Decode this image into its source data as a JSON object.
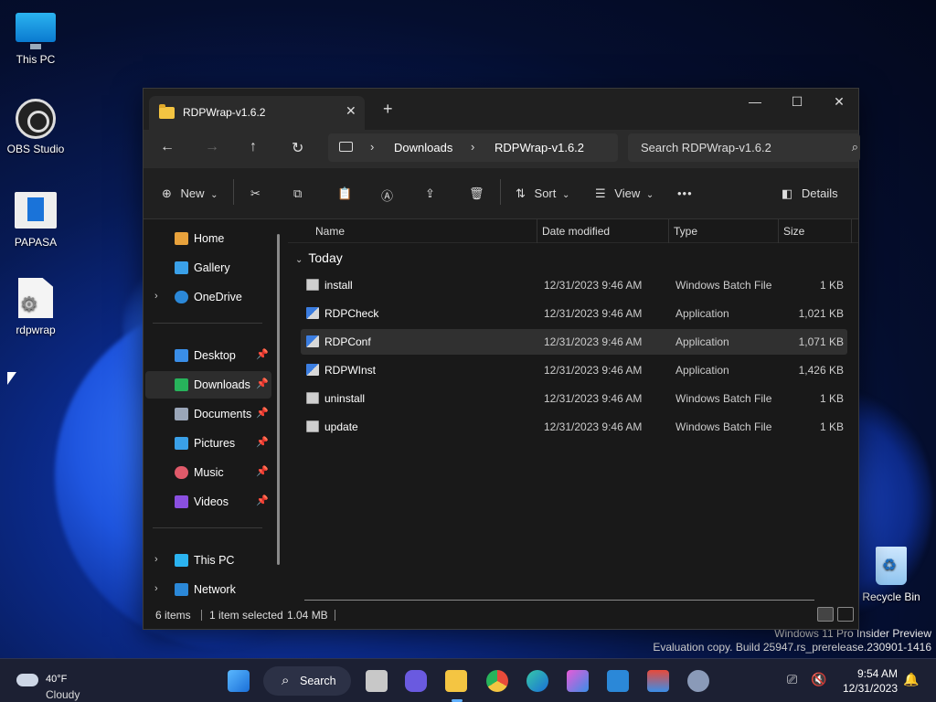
{
  "desktop": {
    "icons": [
      {
        "label": "This PC"
      },
      {
        "label": "OBS Studio"
      },
      {
        "label": "PAPASA"
      },
      {
        "label": "rdpwrap"
      },
      {
        "label": "Recycle Bin"
      }
    ],
    "watermark": {
      "line1": "Windows 11 Pro Insider Preview",
      "line2": "Evaluation copy. Build 25947.rs_prerelease.230901-1416"
    }
  },
  "window": {
    "tab_title": "RDPWrap-v1.6.2",
    "tab_close": "✕",
    "new_tab": "+",
    "controls": {
      "minimize": "—",
      "maximize": "☐",
      "close": "✕"
    },
    "nav": {
      "back": "←",
      "forward": "→",
      "up": "↑",
      "refresh": "↻"
    },
    "breadcrumb": [
      "Downloads",
      "RDPWrap-v1.6.2"
    ],
    "breadcrumb_sep": "›",
    "search_placeholder": "Search RDPWrap-v1.6.2",
    "search_icon": "⌕",
    "toolbar": {
      "new_label": "New",
      "sort_label": "Sort",
      "view_label": "View",
      "more_label": "•••",
      "details_label": "Details",
      "glyphs": {
        "new": "⊕",
        "cut": "✂",
        "copy": "⧉",
        "paste": "📋",
        "rename": "Ⓐ",
        "share": "⇪",
        "delete": "🗑",
        "sort": "⇅",
        "view": "☰",
        "details": "◧",
        "chev": "⌄"
      }
    },
    "sidebar": {
      "items": [
        {
          "label": "Home",
          "icon": "home-icon",
          "color": "#e8a23c"
        },
        {
          "label": "Gallery",
          "icon": "gallery-icon",
          "color": "#3aa0e8"
        },
        {
          "label": "OneDrive",
          "icon": "onedrive-icon",
          "color": "#2b88d8",
          "expandable": true
        },
        {
          "label": "Desktop",
          "icon": "desktop-icon",
          "color": "#3a8ee8",
          "pinned": true
        },
        {
          "label": "Downloads",
          "icon": "downloads-icon",
          "color": "#27b35b",
          "pinned": true,
          "selected": true
        },
        {
          "label": "Documents",
          "icon": "documents-icon",
          "color": "#9aa6b8",
          "pinned": true
        },
        {
          "label": "Pictures",
          "icon": "pictures-icon",
          "color": "#3aa0e8",
          "pinned": true
        },
        {
          "label": "Music",
          "icon": "music-icon",
          "color": "#e05a6a",
          "pinned": true
        },
        {
          "label": "Videos",
          "icon": "videos-icon",
          "color": "#8a4fe0",
          "pinned": true
        },
        {
          "label": "This PC",
          "icon": "this-pc-icon",
          "color": "#2bb3f0",
          "expandable": true
        },
        {
          "label": "Network",
          "icon": "network-icon",
          "color": "#2b88d8",
          "expandable": true
        }
      ],
      "pin_glyph": "📌",
      "chev_glyph": "›"
    },
    "columns": {
      "name": "Name",
      "date": "Date modified",
      "type": "Type",
      "size": "Size"
    },
    "group_label": "Today",
    "group_chev": "⌄",
    "files": [
      {
        "name": "install",
        "date": "12/31/2023 9:46 AM",
        "type": "Windows Batch File",
        "size": "1 KB",
        "kind": "bat"
      },
      {
        "name": "RDPCheck",
        "date": "12/31/2023 9:46 AM",
        "type": "Application",
        "size": "1,021 KB",
        "kind": "app"
      },
      {
        "name": "RDPConf",
        "date": "12/31/2023 9:46 AM",
        "type": "Application",
        "size": "1,071 KB",
        "kind": "app",
        "selected": true
      },
      {
        "name": "RDPWInst",
        "date": "12/31/2023 9:46 AM",
        "type": "Application",
        "size": "1,426 KB",
        "kind": "app"
      },
      {
        "name": "uninstall",
        "date": "12/31/2023 9:46 AM",
        "type": "Windows Batch File",
        "size": "1 KB",
        "kind": "bat"
      },
      {
        "name": "update",
        "date": "12/31/2023 9:46 AM",
        "type": "Windows Batch File",
        "size": "1 KB",
        "kind": "bat"
      }
    ],
    "status": {
      "count": "6 items",
      "selected": "1 item selected",
      "size": "1.04 MB"
    }
  },
  "taskbar": {
    "weather": {
      "temp": "40°F",
      "condition": "Cloudy"
    },
    "search_label": "Search",
    "search_icon": "⌕",
    "apps": [
      {
        "name": "start-button",
        "color": "#3aa0ff"
      },
      {
        "name": "task-view-icon",
        "color": "#c8c8c8"
      },
      {
        "name": "meet-icon",
        "color": "#6a5ae0"
      },
      {
        "name": "file-explorer-icon",
        "color": "#f4c542"
      },
      {
        "name": "chrome-icon",
        "color": "#e84a3a"
      },
      {
        "name": "edge-icon",
        "color": "#1fa0c8"
      },
      {
        "name": "copilot-icon",
        "color": "#8a6ae8"
      },
      {
        "name": "mail-icon",
        "color": "#2b88d8"
      },
      {
        "name": "store-icon",
        "color": "#3a8ee8"
      },
      {
        "name": "settings-icon",
        "color": "#8a9ab8"
      }
    ],
    "tray": {
      "network": "⎚",
      "volume": "🔇",
      "bell": "🔔"
    },
    "time": "9:54 AM",
    "date": "12/31/2023"
  }
}
